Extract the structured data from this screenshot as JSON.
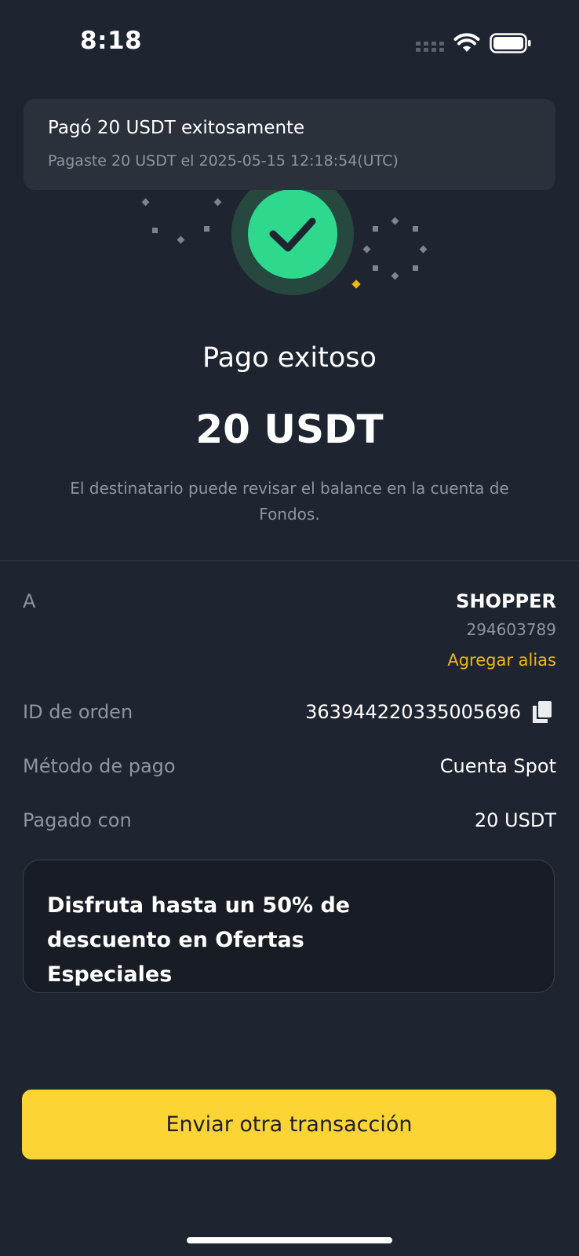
{
  "status_bar": {
    "time": "8:18"
  },
  "toast": {
    "title": "Pagó 20 USDT exitosamente",
    "subtitle": "Pagaste 20 USDT el 2025-05-15 12:18:54(UTC)"
  },
  "result": {
    "title": "Pago exitoso",
    "amount": "20 USDT",
    "description": "El destinatario puede revisar el balance en la cuenta de Fondos."
  },
  "details": {
    "recipient_label": "A",
    "recipient_name": "SHOPPER",
    "recipient_id": "294603789",
    "add_alias": "Agregar alias",
    "order_id_label": "ID de orden",
    "order_id": "363944220335005696",
    "payment_method_label": "Método de pago",
    "payment_method": "Cuenta Spot",
    "paid_with_label": "Pagado con",
    "paid_with": "20 USDT"
  },
  "promo": {
    "text": "Disfruta hasta un 50% de descuento en Ofertas Especiales"
  },
  "actions": {
    "send_again": "Enviar otra transacción"
  },
  "colors": {
    "background": "#1f2530",
    "accent_yellow": "#fcd535",
    "link_yellow": "#f0b90b",
    "success_green": "#2ed98e",
    "muted_text": "#8e94a0"
  },
  "icons": [
    "cellular-signal-icon",
    "wifi-icon",
    "battery-icon",
    "checkmark-icon",
    "copy-icon"
  ]
}
